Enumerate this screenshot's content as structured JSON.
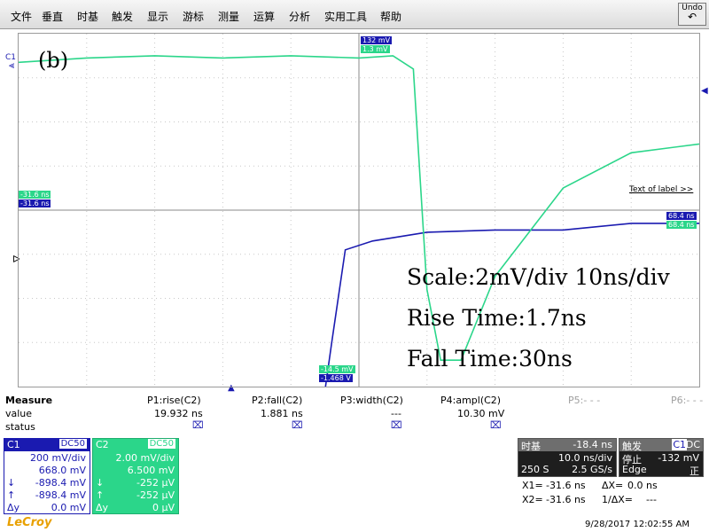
{
  "menu": [
    "文件",
    "垂直",
    "时基",
    "触发",
    "显示",
    "游标",
    "测量",
    "运算",
    "分析",
    "实用工具",
    "帮助"
  ],
  "undo_label": "Undo",
  "colors": {
    "ch1": "#1a1ab0",
    "ch2": "#2bd68a",
    "c1_panel": "#1a1ab0",
    "c2_panel": "#2bd68a",
    "brand": "#e8a000"
  },
  "overlay": {
    "panel": "(b)",
    "scale": "Scale:2mV/div 10ns/div",
    "rise": "Rise Time:1.7ns",
    "fall": "Fall Time:30ns"
  },
  "plot_labels": {
    "c1_marker": "C1",
    "c1_top_blue": "132 mV",
    "c1_top_green": "1.3 mV",
    "left_green": "-31.6 ns",
    "left_blue": "-31.6 ns",
    "right_blue": "68.4 ns",
    "right_green": "68.4 ns",
    "bottom_green": "-14.5 mV",
    "bottom_blue": "-1.468 V",
    "text_of_label": "Text of label >>"
  },
  "chart_data": {
    "type": "line",
    "series": [
      {
        "name": "C1",
        "x": [
          0,
          10,
          20,
          30,
          40,
          45,
          46,
          48,
          52,
          60,
          70,
          80,
          90,
          100
        ],
        "y": [
          -4.1,
          -4.05,
          -4.1,
          -4.05,
          -4.1,
          -4.1,
          -3.0,
          -0.9,
          -0.7,
          -0.5,
          -0.45,
          -0.45,
          -0.3,
          -0.3
        ]
      },
      {
        "name": "C2",
        "x": [
          0,
          10,
          20,
          30,
          40,
          50,
          55,
          58,
          60,
          62,
          65,
          70,
          80,
          90,
          100
        ],
        "y": [
          3.35,
          3.45,
          3.5,
          3.45,
          3.5,
          3.45,
          3.5,
          3.2,
          -1.8,
          -3.4,
          -3.4,
          -1.5,
          0.5,
          1.3,
          1.5
        ]
      }
    ],
    "xlim": [
      0,
      100
    ],
    "ylim": [
      -4,
      4
    ],
    "grid": true
  },
  "measure": {
    "title": "Measure",
    "rows": [
      "value",
      "status"
    ],
    "params": [
      {
        "name": "P1:rise(C2)",
        "value": "19.932 ns",
        "status": "⌧"
      },
      {
        "name": "P2:fall(C2)",
        "value": "1.881 ns",
        "status": "⌧"
      },
      {
        "name": "P3:width(C2)",
        "value": "---",
        "status": "⌧"
      },
      {
        "name": "P4:ampl(C2)",
        "value": "10.30 mV",
        "status": "⌧"
      },
      {
        "name": "P5:- - -",
        "value": "",
        "status": ""
      },
      {
        "name": "P6:- - -",
        "value": "",
        "status": ""
      }
    ]
  },
  "c1": {
    "label": "C1",
    "coupling": "DC50",
    "scale": "200 mV/div",
    "offset": "668.0 mV",
    "down_label": "↓",
    "down": "-898.4 mV",
    "up_label": "↑",
    "up": "-898.4 mV",
    "dy_label": "Δy",
    "dy": "0.0 mV"
  },
  "c2": {
    "label": "C2",
    "coupling": "DC50",
    "scale": "2.00 mV/div",
    "offset": "6.500 mV",
    "down_label": "↓",
    "down": "-252 μV",
    "up_label": "↑",
    "up": "-252 μV",
    "dy_label": "Δy",
    "dy": "0 μV"
  },
  "timebase": {
    "title": "时基",
    "delay": "-18.4 ns",
    "scale": "10.0 ns/div",
    "samples": "250 S",
    "rate": "2.5 GS/s"
  },
  "trigger": {
    "title": "触发",
    "source": "C1",
    "coupling": "DC",
    "mode": "停止",
    "level": "-132 mV",
    "type": "Edge",
    "slope": "正"
  },
  "cursors": {
    "x1_label": "X1=",
    "x1": "-31.6 ns",
    "dx_label": "ΔX=",
    "dx": "0.0 ns",
    "x2_label": "X2=",
    "x2": "-31.6 ns",
    "inv_dx_label": "1/ΔX=",
    "inv_dx": "---"
  },
  "brand": "LeCroy",
  "timestamp": "9/28/2017 12:02:55 AM"
}
